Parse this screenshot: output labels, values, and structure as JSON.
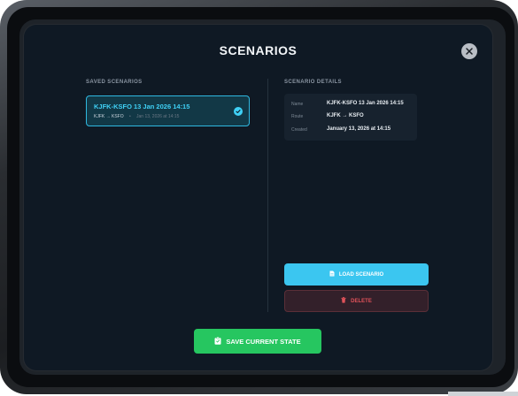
{
  "modal": {
    "title": "SCENARIOS"
  },
  "saved": {
    "section_label": "SAVED SCENARIOS",
    "items": [
      {
        "name": "KJFK-KSFO 13 Jan 2026 14:15",
        "route": "KJFK → KSFO",
        "separator": "•",
        "date": "Jan 13, 2026 at 14:15",
        "selected": true
      }
    ]
  },
  "details": {
    "section_label": "SCENARIO DETAILS",
    "rows": [
      {
        "key": "Name",
        "value": "KJFK-KSFO 13 Jan 2026 14:15"
      },
      {
        "key": "Route",
        "value": "KJFK → KSFO"
      },
      {
        "key": "Created",
        "value": "January 13, 2026 at 14:15"
      }
    ]
  },
  "actions": {
    "load_label": "LOAD SCENARIO",
    "delete_label": "DELETE",
    "save_label": "SAVE CURRENT STATE"
  },
  "icons": {
    "close": "close-icon",
    "check": "check-circle-icon",
    "load": "file-icon",
    "delete": "trash-icon",
    "save": "clipboard-icon"
  },
  "colors": {
    "accent": "#3fd0f5",
    "load_button": "#3bc6f0",
    "delete_text": "#e0525a",
    "save_button": "#26c660",
    "modal_bg": "#0f1924"
  }
}
